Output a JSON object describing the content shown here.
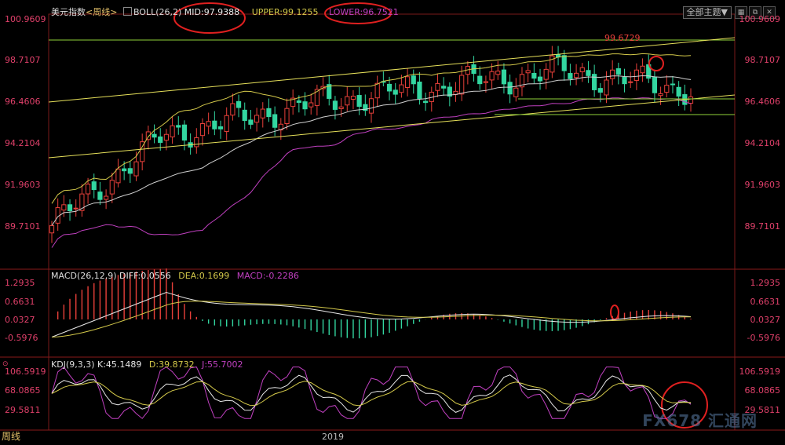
{
  "main": {
    "title": "美元指数",
    "period": "<周线>",
    "indicator": "BOLL(26,2)",
    "mid": "MID:97.9388",
    "upper": "UPPER:99.1255",
    "lower": "LOWER:96.7521",
    "peak_label": "99.6729",
    "ticks": [
      "100.9609",
      "98.7107",
      "96.4606",
      "94.2104",
      "91.9603",
      "89.7101"
    ]
  },
  "macd": {
    "indicator": "MACD(26,12,9)",
    "diff": "DIFF:0.0556",
    "dea": "DEA:0.1699",
    "macd": "MACD:-0.2286",
    "ticks": [
      "1.2935",
      "0.6631",
      "0.0327",
      "-0.5976"
    ]
  },
  "kdj": {
    "indicator": "KDJ(9,3,3)",
    "k": "K:45.1489",
    "d": "D:39.8732",
    "j": "J:55.7002",
    "ticks": [
      "106.5919",
      "68.0865",
      "29.5811"
    ]
  },
  "toolbar": {
    "theme_button": "全部主题",
    "theme_arrow": "▼"
  },
  "bottom": {
    "period_tab": "周线",
    "year_label": "2019"
  },
  "watermark": "FX678 汇通网",
  "colors": {
    "up": "#e8403a",
    "down": "#33d6a0",
    "mid": "#d0d0d0",
    "upper": "#d4c94a",
    "lower": "#c040c0",
    "trend": "#8fd23a",
    "axis": "#e0406a",
    "highlight": "#e02020"
  }
}
